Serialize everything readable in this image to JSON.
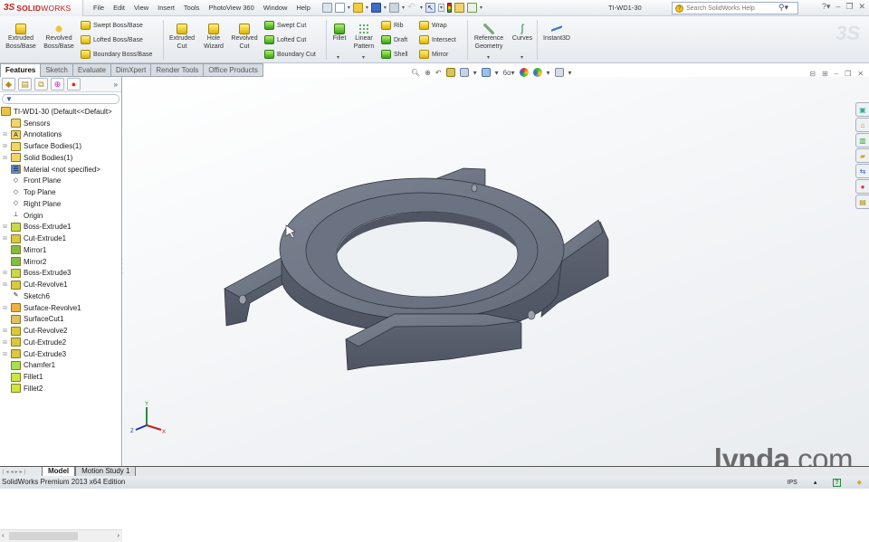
{
  "app": {
    "logo_ds": "3S",
    "logo_name_bold": "SOLID",
    "logo_name": "WORKS",
    "document_title": "TI-WD1-30"
  },
  "menu": [
    "File",
    "Edit",
    "View",
    "Insert",
    "Tools",
    "PhotoView 360",
    "Window",
    "Help"
  ],
  "search": {
    "placeholder": "Search SolidWorks Help"
  },
  "command_manager": {
    "large_buttons": [
      {
        "id": "extruded-boss",
        "label1": "Extruded",
        "label2": "Boss/Base"
      },
      {
        "id": "revolved-boss",
        "label1": "Revolved",
        "label2": "Boss/Base"
      },
      {
        "id": "extruded-cut",
        "label1": "Extruded",
        "label2": "Cut"
      },
      {
        "id": "hole-wizard",
        "label1": "Hole",
        "label2": "Wizard"
      },
      {
        "id": "revolved-cut",
        "label1": "Revolved",
        "label2": "Cut"
      },
      {
        "id": "fillet",
        "label1": "Fillet",
        "label2": ""
      },
      {
        "id": "linear-pattern",
        "label1": "Linear",
        "label2": "Pattern"
      },
      {
        "id": "reference-geometry",
        "label1": "Reference",
        "label2": "Geometry"
      },
      {
        "id": "curves",
        "label1": "Curves",
        "label2": ""
      },
      {
        "id": "instant3d",
        "label1": "Instant3D",
        "label2": ""
      }
    ],
    "small_buttons": [
      "Swept Boss/Base",
      "Lofted Boss/Base",
      "Boundary Boss/Base",
      "Swept Cut",
      "Lofted Cut",
      "Boundary Cut",
      "Rib",
      "Draft",
      "Shell",
      "Wrap",
      "Intersect",
      "Mirror"
    ]
  },
  "tabs": [
    {
      "label": "Features",
      "active": true
    },
    {
      "label": "Sketch"
    },
    {
      "label": "Evaluate"
    },
    {
      "label": "DimXpert"
    },
    {
      "label": "Render Tools"
    },
    {
      "label": "Office Products"
    }
  ],
  "feature_tree": {
    "root": "TI-WD1-30  (Default<<Default>",
    "items": [
      {
        "label": "Sensors",
        "expand": false,
        "icon": "sensors-icon"
      },
      {
        "label": "Annotations",
        "expand": true,
        "icon": "annotations-icon"
      },
      {
        "label": "Surface Bodies(1)",
        "expand": true,
        "icon": "surface-bodies-icon"
      },
      {
        "label": "Solid Bodies(1)",
        "expand": true,
        "icon": "solid-bodies-icon"
      },
      {
        "label": "Material <not specified>",
        "expand": false,
        "icon": "material-icon"
      },
      {
        "label": "Front Plane",
        "expand": false,
        "icon": "plane-icon"
      },
      {
        "label": "Top Plane",
        "expand": false,
        "icon": "plane-icon"
      },
      {
        "label": "Right Plane",
        "expand": false,
        "icon": "plane-icon"
      },
      {
        "label": "Origin",
        "expand": false,
        "icon": "origin-icon"
      },
      {
        "label": "Boss-Extrude1",
        "expand": true,
        "icon": "boss-extrude-icon"
      },
      {
        "label": "Cut-Extrude1",
        "expand": true,
        "icon": "cut-extrude-icon"
      },
      {
        "label": "Mirror1",
        "expand": false,
        "icon": "mirror-icon"
      },
      {
        "label": "Mirror2",
        "expand": false,
        "icon": "mirror-icon"
      },
      {
        "label": "Boss-Extrude3",
        "expand": true,
        "icon": "boss-extrude-icon"
      },
      {
        "label": "Cut-Revolve1",
        "expand": true,
        "icon": "cut-revolve-icon"
      },
      {
        "label": "Sketch6",
        "expand": false,
        "icon": "sketch-icon"
      },
      {
        "label": "Surface-Revolve1",
        "expand": true,
        "icon": "surface-revolve-icon"
      },
      {
        "label": "SurfaceCut1",
        "expand": false,
        "icon": "surface-cut-icon"
      },
      {
        "label": "Cut-Revolve2",
        "expand": true,
        "icon": "cut-revolve-icon"
      },
      {
        "label": "Cut-Extrude2",
        "expand": true,
        "icon": "cut-extrude-icon"
      },
      {
        "label": "Cut-Extrude3",
        "expand": true,
        "icon": "cut-extrude-icon"
      },
      {
        "label": "Chamfer1",
        "expand": false,
        "icon": "chamfer-icon"
      },
      {
        "label": "Fillet1",
        "expand": false,
        "icon": "fillet-icon"
      },
      {
        "label": "Fillet2",
        "expand": false,
        "icon": "fillet-icon"
      }
    ]
  },
  "bottom_tabs": [
    {
      "label": "Model",
      "active": true
    },
    {
      "label": "Motion Study 1"
    }
  ],
  "status": {
    "edition": "SolidWorks Premium 2013 x64 Edition",
    "units": "IPS"
  },
  "triad": {
    "x": "X",
    "y": "Y",
    "z": "Z"
  },
  "watermark": {
    "bold": "lynda",
    "rest": ".com"
  },
  "colors": {
    "accent": "#c0221e",
    "model": "#6d7584"
  }
}
